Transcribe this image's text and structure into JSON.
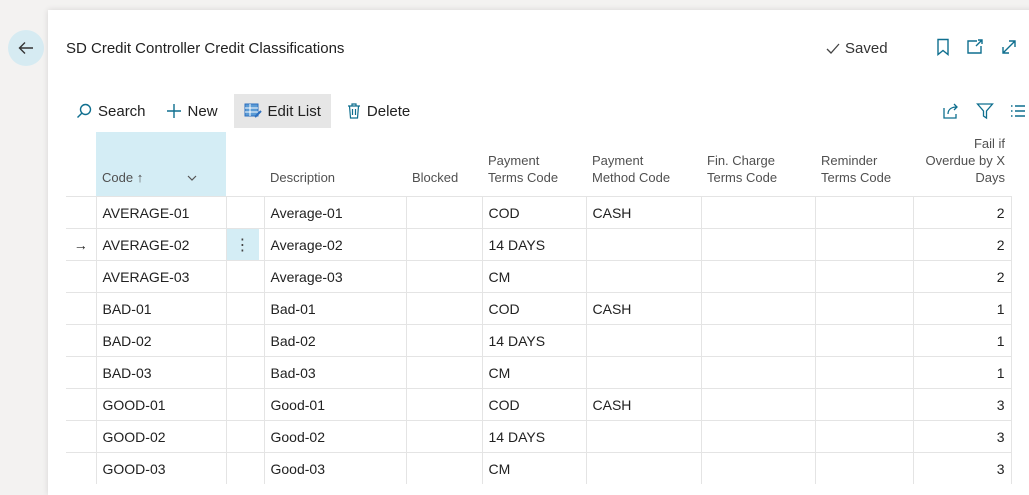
{
  "page": {
    "title": "SD Credit Controller Credit Classifications",
    "saved_label": "Saved",
    "icons": {
      "back": "arrow-left-icon",
      "saved": "checkmark-icon",
      "bookmark": "bookmark-icon",
      "open_new": "open-in-new-window-icon",
      "expand": "expand-icon"
    }
  },
  "toolbar": {
    "search_label": "Search",
    "new_label": "New",
    "edit_list_label": "Edit List",
    "delete_label": "Delete",
    "icons": {
      "search": "search-icon",
      "new": "plus-icon",
      "edit_list": "edit-list-icon",
      "delete": "trash-icon",
      "share": "share-icon",
      "filter": "filter-icon",
      "list": "list-view-icon"
    }
  },
  "table": {
    "columns": {
      "code": "Code",
      "code_sort_indicator": "↑",
      "description": "Description",
      "blocked": "Blocked",
      "payment_terms_line1": "Payment",
      "payment_terms_line2": "Terms Code",
      "payment_method_line1": "Payment",
      "payment_method_line2": "Method Code",
      "fin_charge_line1": "Fin. Charge",
      "fin_charge_line2": "Terms Code",
      "reminder_line1": "Reminder",
      "reminder_line2": "Terms Code",
      "fail_line1": "Fail if",
      "fail_line2": "Overdue by X",
      "fail_line3": "Days"
    },
    "current_row_indicator": "→",
    "row_menu_glyph": "⋮",
    "rows": [
      {
        "code": "AVERAGE-01",
        "description": "Average-01",
        "blocked": "",
        "payment_terms": "COD",
        "payment_method": "CASH",
        "fin_charge": "",
        "reminder": "",
        "fail_days": "2",
        "current": ""
      },
      {
        "code": "AVERAGE-02",
        "description": "Average-02",
        "blocked": "",
        "payment_terms": "14 DAYS",
        "payment_method": "",
        "fin_charge": "",
        "reminder": "",
        "fail_days": "2",
        "current": "→"
      },
      {
        "code": "AVERAGE-03",
        "description": "Average-03",
        "blocked": "",
        "payment_terms": "CM",
        "payment_method": "",
        "fin_charge": "",
        "reminder": "",
        "fail_days": "2",
        "current": ""
      },
      {
        "code": "BAD-01",
        "description": "Bad-01",
        "blocked": "",
        "payment_terms": "COD",
        "payment_method": "CASH",
        "fin_charge": "",
        "reminder": "",
        "fail_days": "1",
        "current": ""
      },
      {
        "code": "BAD-02",
        "description": "Bad-02",
        "blocked": "",
        "payment_terms": "14 DAYS",
        "payment_method": "",
        "fin_charge": "",
        "reminder": "",
        "fail_days": "1",
        "current": ""
      },
      {
        "code": "BAD-03",
        "description": "Bad-03",
        "blocked": "",
        "payment_terms": "CM",
        "payment_method": "",
        "fin_charge": "",
        "reminder": "",
        "fail_days": "1",
        "current": ""
      },
      {
        "code": "GOOD-01",
        "description": "Good-01",
        "blocked": "",
        "payment_terms": "COD",
        "payment_method": "CASH",
        "fin_charge": "",
        "reminder": "",
        "fail_days": "3",
        "current": ""
      },
      {
        "code": "GOOD-02",
        "description": "Good-02",
        "blocked": "",
        "payment_terms": "14 DAYS",
        "payment_method": "",
        "fin_charge": "",
        "reminder": "",
        "fail_days": "3",
        "current": ""
      },
      {
        "code": "GOOD-03",
        "description": "Good-03",
        "blocked": "",
        "payment_terms": "CM",
        "payment_method": "",
        "fin_charge": "",
        "reminder": "",
        "fail_days": "3",
        "current": ""
      }
    ]
  },
  "colors": {
    "accent_light": "#d4edf5",
    "accent_icon": "#0f6f8f",
    "edit_list_icon": "#2c6fbf"
  }
}
